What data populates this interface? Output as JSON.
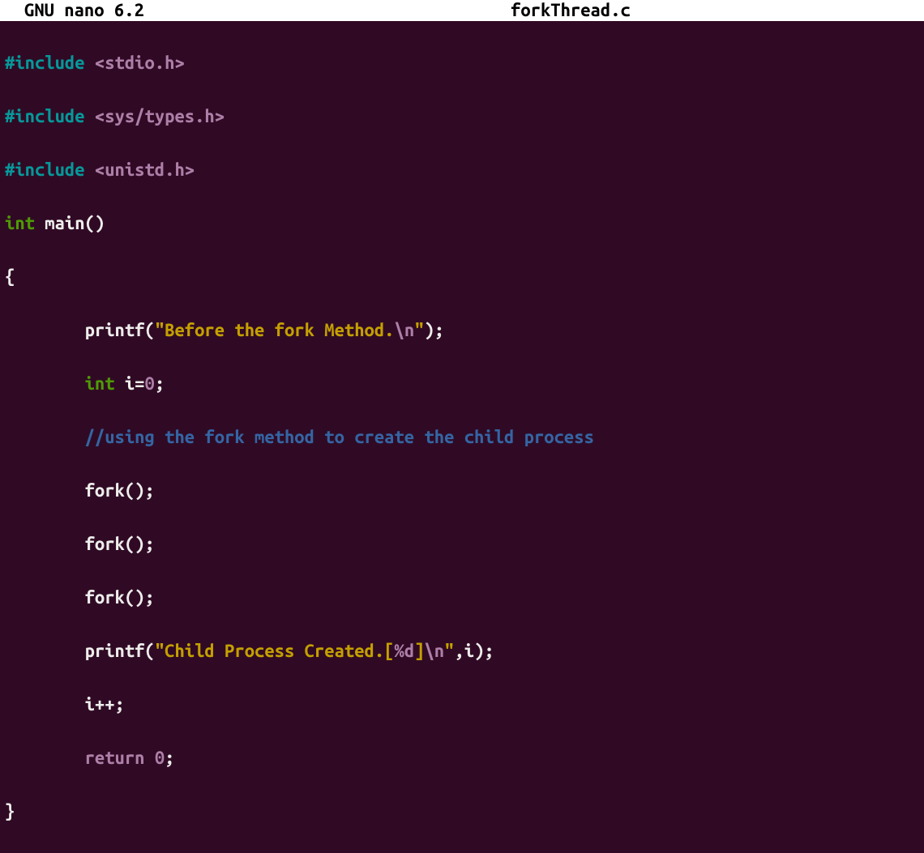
{
  "titlebar": {
    "app": "GNU nano 6.2",
    "filename": "forkThread.c"
  },
  "code": {
    "line1": {
      "a": "#include",
      "b": " ",
      "c": "<stdio.h>"
    },
    "line2": {
      "a": "#include",
      "b": " ",
      "c": "<sys/types.h>"
    },
    "line3": {
      "a": "#include",
      "b": " ",
      "c": "<unistd.h>"
    },
    "line4": {
      "a": "int",
      "b": " main()"
    },
    "line5": "{",
    "line6": {
      "indent": "        ",
      "a": "printf(",
      "b": "\"Before the fork Method.",
      "c": "\\n",
      "d": "\"",
      "e": ");"
    },
    "line7": {
      "indent": "        ",
      "a": "int",
      "b": " i=",
      "c": "0",
      "d": ";"
    },
    "line8": {
      "indent": "        ",
      "a": "//using the fork method to create the child process"
    },
    "line9": {
      "indent": "        ",
      "a": "fork();"
    },
    "line10": {
      "indent": "        ",
      "a": "fork();"
    },
    "line11": {
      "indent": "        ",
      "a": "fork();"
    },
    "line12": {
      "indent": "        ",
      "a": "printf(",
      "b": "\"Child Process Created.[",
      "c": "%d",
      "d": "]",
      "e": "\\n",
      "f": "\"",
      "g": ",i);"
    },
    "line13": {
      "indent": "        ",
      "a": "i++;"
    },
    "line14": {
      "indent": "        ",
      "a": "return",
      "b": " ",
      "c": "0",
      "d": ";"
    },
    "line15": "}"
  }
}
